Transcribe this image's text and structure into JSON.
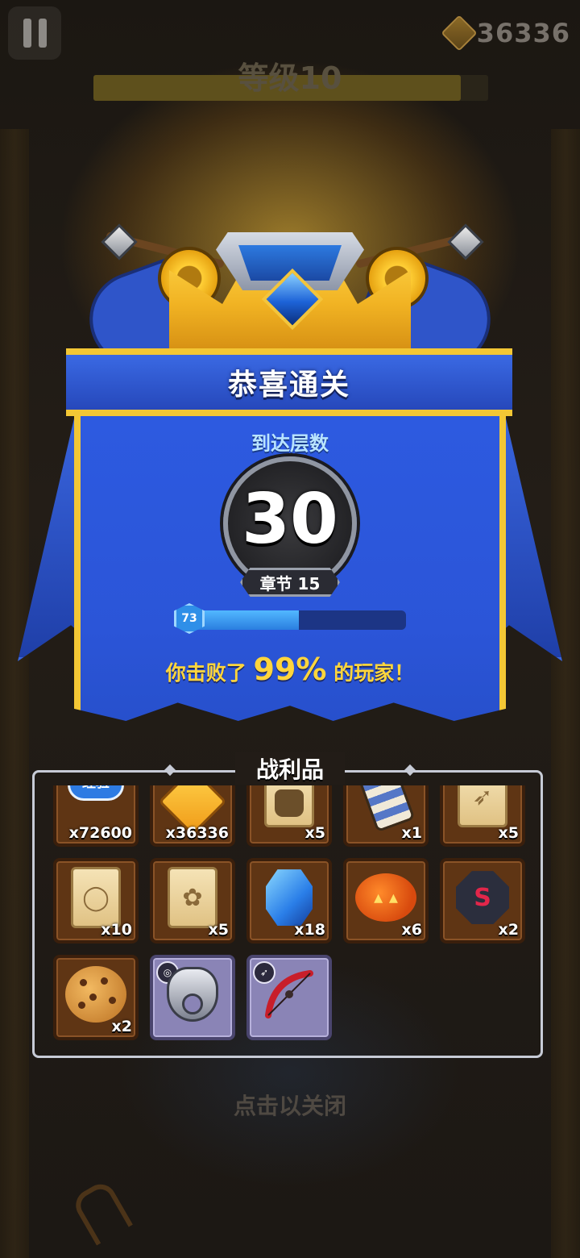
{
  "hud": {
    "currency_value": "36336",
    "level_title": "等级10",
    "level_progress_fraction": 0.93
  },
  "result": {
    "header_title": "恭喜通关",
    "floor_label": "到达层数",
    "floor_number": "30",
    "chapter_label": "章节 15",
    "progress_level": "73",
    "progress_fraction": 0.52,
    "defeat_prefix": "你击败了",
    "defeat_percent": "99%",
    "defeat_suffix": "的玩家！"
  },
  "loot": {
    "title": "战利品",
    "items": [
      {
        "icon": "xp-badge-icon",
        "label": "经验",
        "count": "x72600"
      },
      {
        "icon": "gold-coin-icon",
        "count": "x36336"
      },
      {
        "icon": "armor-scroll-icon",
        "count": "x5"
      },
      {
        "icon": "bracer-icon",
        "count": "x1"
      },
      {
        "icon": "bow-scroll-icon",
        "count": "x5"
      },
      {
        "icon": "ring-scroll-icon",
        "count": "x10"
      },
      {
        "icon": "pet-scroll-icon",
        "count": "x5"
      },
      {
        "icon": "blue-gem-icon",
        "count": "x18"
      },
      {
        "icon": "pumpkin-icon",
        "count": "x6"
      },
      {
        "icon": "dark-stone-icon",
        "count": "x2"
      },
      {
        "icon": "cookie-icon",
        "count": "x2"
      },
      {
        "icon": "wolf-ring-icon",
        "count": ""
      },
      {
        "icon": "red-bow-icon",
        "count": ""
      }
    ]
  },
  "footer": {
    "close_hint": "点击以关闭"
  }
}
